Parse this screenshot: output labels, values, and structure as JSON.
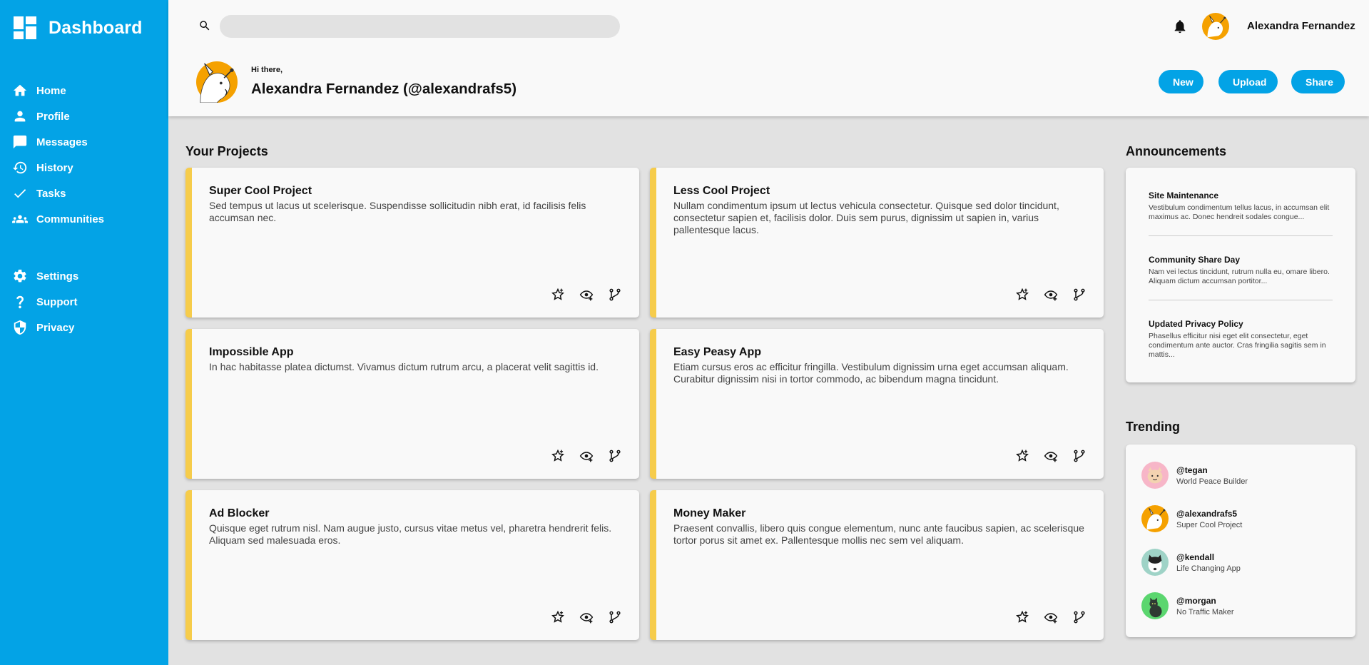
{
  "app": {
    "title": "Dashboard"
  },
  "sidebar": {
    "items": [
      {
        "label": "Home",
        "icon": "home-icon"
      },
      {
        "label": "Profile",
        "icon": "person-icon"
      },
      {
        "label": "Messages",
        "icon": "chat-icon"
      },
      {
        "label": "History",
        "icon": "history-icon"
      },
      {
        "label": "Tasks",
        "icon": "check-icon"
      },
      {
        "label": "Communities",
        "icon": "people-icon"
      }
    ],
    "secondary": [
      {
        "label": "Settings",
        "icon": "gear-icon"
      },
      {
        "label": "Support",
        "icon": "question-icon"
      },
      {
        "label": "Privacy",
        "icon": "shield-icon"
      }
    ]
  },
  "header": {
    "search": {
      "placeholder": "",
      "value": ""
    },
    "user_name": "Alexandra Fernandez",
    "greeting": "Hi there,",
    "full_name": "Alexandra Fernandez (@alexandrafs5)",
    "buttons": {
      "new": "New",
      "upload": "Upload",
      "share": "Share"
    }
  },
  "projects": {
    "title": "Your Projects",
    "items": [
      {
        "title": "Super Cool Project",
        "description": "Sed tempus ut lacus ut scelerisque. Suspendisse sollicitudin nibh erat, id facilisis felis accumsan nec."
      },
      {
        "title": "Less Cool Project",
        "description": "Nullam condimentum ipsum ut lectus vehicula consectetur. Quisque sed dolor tincidunt, consectetur sapien et, facilisis dolor. Duis sem purus, dignissim ut sapien in, varius pallentesque lacus."
      },
      {
        "title": "Impossible App",
        "description": "In hac habitasse platea dictumst. Vivamus dictum rutrum arcu, a placerat velit sagittis id."
      },
      {
        "title": "Easy Peasy App",
        "description": "Etiam cursus eros ac efficitur fringilla. Vestibulum dignissim urna eget accumsan aliquam. Curabitur dignissim nisi in tortor commodo, ac bibendum magna tincidunt."
      },
      {
        "title": "Ad Blocker",
        "description": "Quisque eget rutrum nisl. Nam augue justo, cursus vitae metus vel, pharetra hendrerit felis. Aliquam sed malesuada eros."
      },
      {
        "title": "Money Maker",
        "description": "Praesent convallis, libero quis congue elementum, nunc ante faucibus sapien, ac scelerisque tortor porus sit amet ex. Pallentesque mollis nec sem vel aliquam."
      }
    ]
  },
  "announcements": {
    "title": "Announcements",
    "items": [
      {
        "title": "Site Maintenance",
        "body": "Vestibulum condimentum tellus lacus, in accumsan elit maximus ac. Donec hendreit sodales congue..."
      },
      {
        "title": "Community Share Day",
        "body": "Nam vei lectus tincidunt, rutrum nulla eu, omare libero. Aliquam dictum accumsan portitor..."
      },
      {
        "title": "Updated Privacy Policy",
        "body": "Phasellus efficitur nisi eget elit consectetur, eget condimentum ante auctor. Cras fringilia sagitis sem in mattis..."
      }
    ]
  },
  "trending": {
    "title": "Trending",
    "items": [
      {
        "handle": "@tegan",
        "project": "World Peace Builder",
        "avatar_color": "#f7b6c8"
      },
      {
        "handle": "@alexandrafs5",
        "project": "Super Cool Project",
        "avatar_color": "#f5a100"
      },
      {
        "handle": "@kendall",
        "project": "Life Changing App",
        "avatar_color": "#9fd3c7"
      },
      {
        "handle": "@morgan",
        "project": "No Traffic Maker",
        "avatar_color": "#5bd66f"
      }
    ]
  },
  "colors": {
    "accent": "#03a3e6",
    "card_stripe": "#f6cc4b",
    "background": "#e2e2e2",
    "surface": "#f9f9f9"
  }
}
